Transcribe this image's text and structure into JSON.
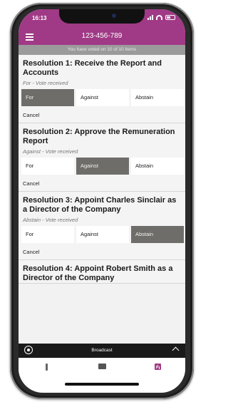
{
  "status_bar": {
    "time": "16:13"
  },
  "app_bar": {
    "title": "123-456-789"
  },
  "banner": {
    "text": "You have voted on 10 of 10 items"
  },
  "resolutions": [
    {
      "title": "Resolution 1: Receive the Report and Accounts",
      "status": "For - Vote received",
      "options": [
        "For",
        "Against",
        "Abstain"
      ],
      "selected": "For",
      "cancel_label": "Cancel"
    },
    {
      "title": "Resolution 2: Approve the Remuneration Report",
      "status": "Against  - Vote received",
      "options": [
        "For",
        "Against",
        "Abstain"
      ],
      "selected": "Against",
      "cancel_label": "Cancel"
    },
    {
      "title": "Resolution 3: Appoint Charles Sinclair as a Director of the Company",
      "status": "Abstain - Vote received",
      "options": [
        "For",
        "Against",
        "Abstain"
      ],
      "selected": "Abstain",
      "cancel_label": "Cancel"
    },
    {
      "title": "Resolution 4: Appoint Robert Smith as a Director of the Company"
    }
  ],
  "bottom_bar": {
    "label": "Broadcast"
  },
  "tab_bar": {
    "tabs": [
      {
        "icon": "info-icon"
      },
      {
        "icon": "chat-icon"
      },
      {
        "icon": "chart-icon",
        "active": true
      }
    ]
  },
  "colors": {
    "brand": "#a03a86",
    "selected": "#6e6d6a",
    "banner": "#9b9b9b"
  }
}
